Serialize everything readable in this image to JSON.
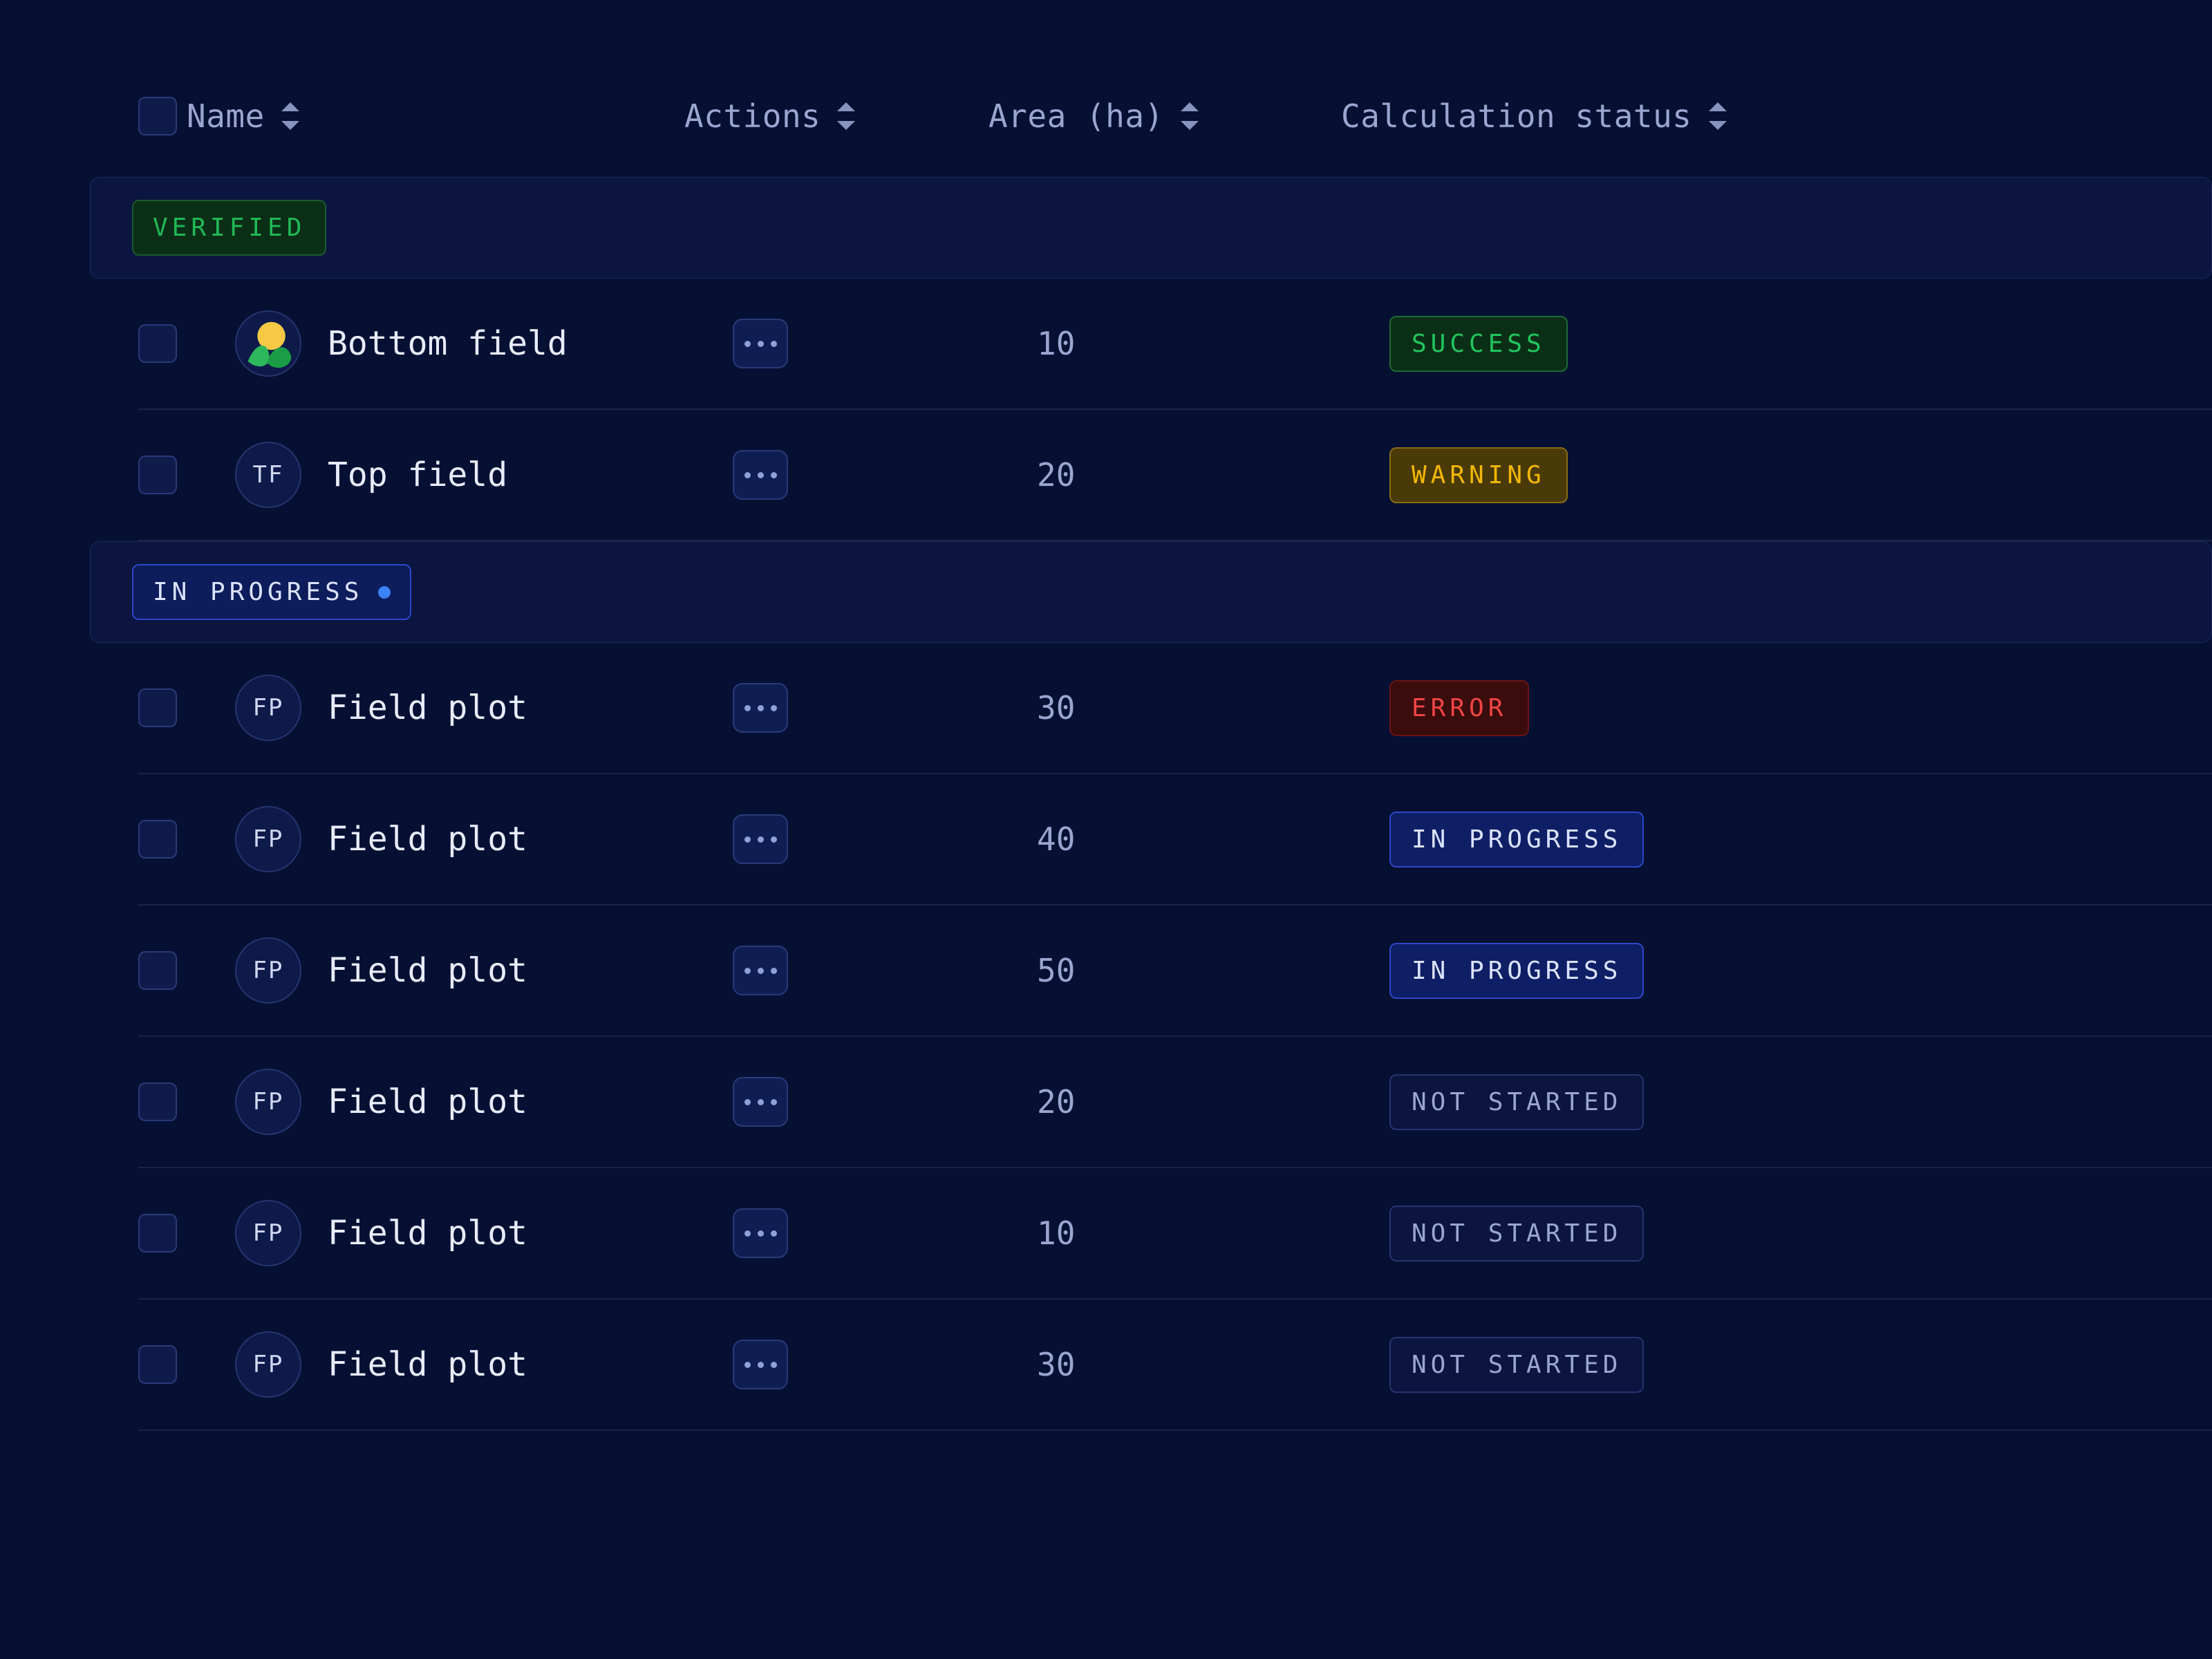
{
  "columns": {
    "name": "Name",
    "actions": "Actions",
    "area": "Area (ha)",
    "status": "Calculation status"
  },
  "groups": [
    {
      "id": "verified",
      "label": "VERIFIED",
      "tag_class": "tag-verified",
      "show_dot": false,
      "rows": [
        {
          "avatar_kind": "leaf",
          "avatar_text": "",
          "name": "Bottom field",
          "area": "10",
          "status_label": "SUCCESS",
          "status_class": "st-success"
        },
        {
          "avatar_kind": "text",
          "avatar_text": "TF",
          "name": "Top field",
          "area": "20",
          "status_label": "WARNING",
          "status_class": "st-warning"
        }
      ]
    },
    {
      "id": "in_progress",
      "label": "IN PROGRESS",
      "tag_class": "tag-inprogress-group",
      "show_dot": true,
      "rows": [
        {
          "avatar_kind": "text",
          "avatar_text": "FP",
          "name": "Field plot",
          "area": "30",
          "status_label": "ERROR",
          "status_class": "st-error"
        },
        {
          "avatar_kind": "text",
          "avatar_text": "FP",
          "name": "Field plot",
          "area": "40",
          "status_label": "IN PROGRESS",
          "status_class": "st-inprogress"
        },
        {
          "avatar_kind": "text",
          "avatar_text": "FP",
          "name": "Field plot",
          "area": "50",
          "status_label": "IN PROGRESS",
          "status_class": "st-inprogress"
        },
        {
          "avatar_kind": "text",
          "avatar_text": "FP",
          "name": "Field plot",
          "area": "20",
          "status_label": "NOT STARTED",
          "status_class": "st-notstarted"
        },
        {
          "avatar_kind": "text",
          "avatar_text": "FP",
          "name": "Field plot",
          "area": "10",
          "status_label": "NOT STARTED",
          "status_class": "st-notstarted"
        },
        {
          "avatar_kind": "text",
          "avatar_text": "FP",
          "name": "Field plot",
          "area": "30",
          "status_label": "NOT STARTED",
          "status_class": "st-notstarted"
        }
      ]
    }
  ]
}
